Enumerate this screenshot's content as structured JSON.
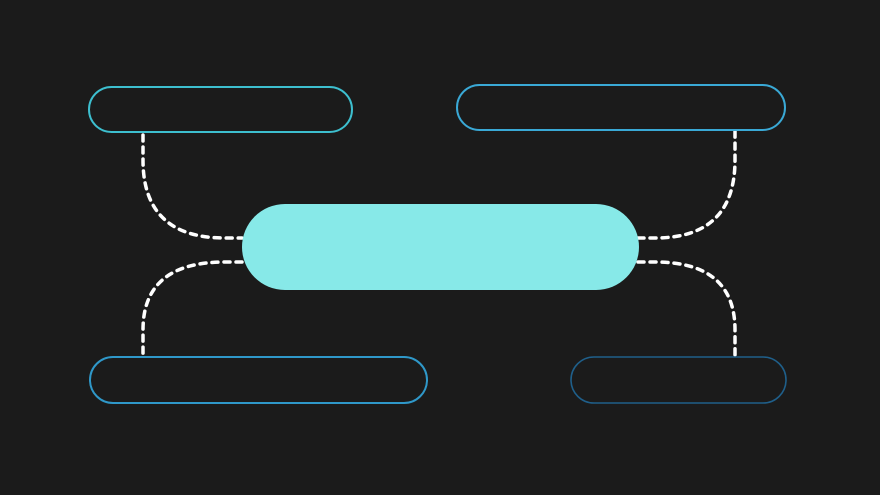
{
  "colors": {
    "background": "#1b1b1b",
    "center_fill": "#87e9e8",
    "connector": "#ffffff",
    "box_top_left": "#3dbfcf",
    "box_top_right": "#3aa9d6",
    "box_bottom_left": "#2f98c9",
    "box_bottom_right": "#1f5f8a"
  },
  "nodes": {
    "center": {
      "label": ""
    },
    "top_left": {
      "label": ""
    },
    "top_right": {
      "label": ""
    },
    "bottom_left": {
      "label": ""
    },
    "bottom_right": {
      "label": ""
    }
  }
}
